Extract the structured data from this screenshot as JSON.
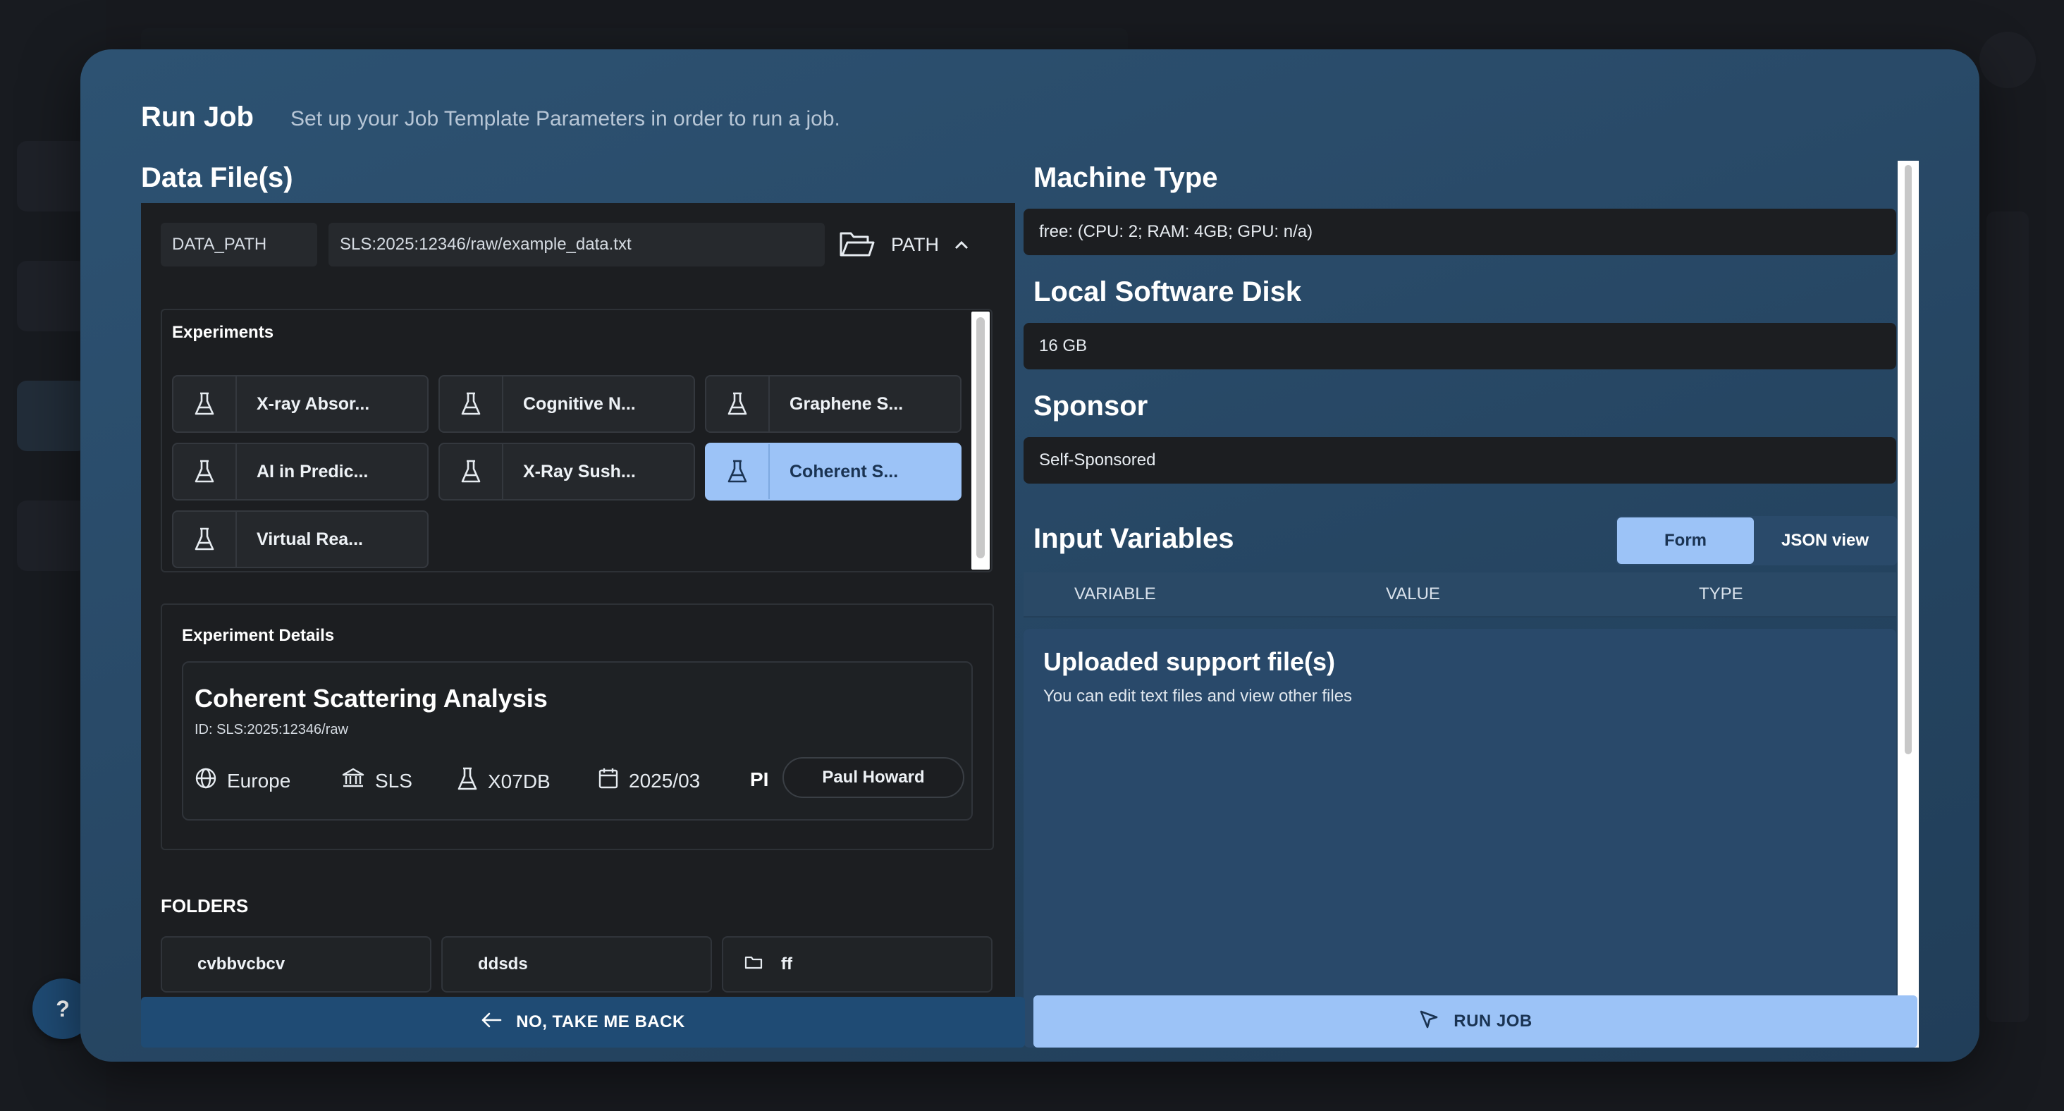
{
  "modal": {
    "title": "Run Job",
    "subtitle": "Set up your Job Template Parameters in order to run a job."
  },
  "data_files": {
    "title": "Data File(s)",
    "path_name": "DATA_PATH",
    "path_value": "SLS:2025:12346/raw/example_data.txt",
    "path_toggle_label": "PATH",
    "experiments_label": "Experiments",
    "experiments": [
      {
        "label": "X-ray Absor...",
        "selected": false
      },
      {
        "label": "Cognitive N...",
        "selected": false
      },
      {
        "label": "Graphene S...",
        "selected": false
      },
      {
        "label": "AI in Predic...",
        "selected": false
      },
      {
        "label": "X-Ray Sush...",
        "selected": false
      },
      {
        "label": "Coherent S...",
        "selected": true
      },
      {
        "label": "Virtual Rea...",
        "selected": false
      }
    ],
    "details": {
      "label": "Experiment Details",
      "name": "Coherent Scattering Analysis",
      "id": "ID: SLS:2025:12346/raw",
      "region": "Europe",
      "facility": "SLS",
      "beamline": "X07DB",
      "date": "2025/03",
      "pi_label": "PI",
      "pi_name": "Paul Howard"
    },
    "folders_label": "FOLDERS",
    "folders": [
      {
        "label": "cvbbvcbcv"
      },
      {
        "label": "ddsds"
      },
      {
        "label": "ff"
      }
    ]
  },
  "machine_type": {
    "title": "Machine Type",
    "value": "free: (CPU: 2; RAM: 4GB; GPU: n/a)"
  },
  "local_disk": {
    "title": "Local Software Disk",
    "value": "16 GB"
  },
  "sponsor": {
    "title": "Sponsor",
    "value": "Self-Sponsored"
  },
  "input_variables": {
    "title": "Input Variables",
    "view_form": "Form",
    "view_json": "JSON view",
    "columns": [
      "VARIABLE",
      "VALUE",
      "TYPE"
    ]
  },
  "support_files": {
    "title": "Uploaded support file(s)",
    "subtitle": "You can edit text files and view other files"
  },
  "footer": {
    "back_label": "NO, TAKE ME BACK",
    "run_label": "RUN JOB"
  },
  "help": {
    "label": "?"
  },
  "colors": {
    "accent": "#9cc3f7",
    "modal_bg": "#294a68",
    "panel_bg": "#1c1e21",
    "back_button": "#1f4b74"
  }
}
